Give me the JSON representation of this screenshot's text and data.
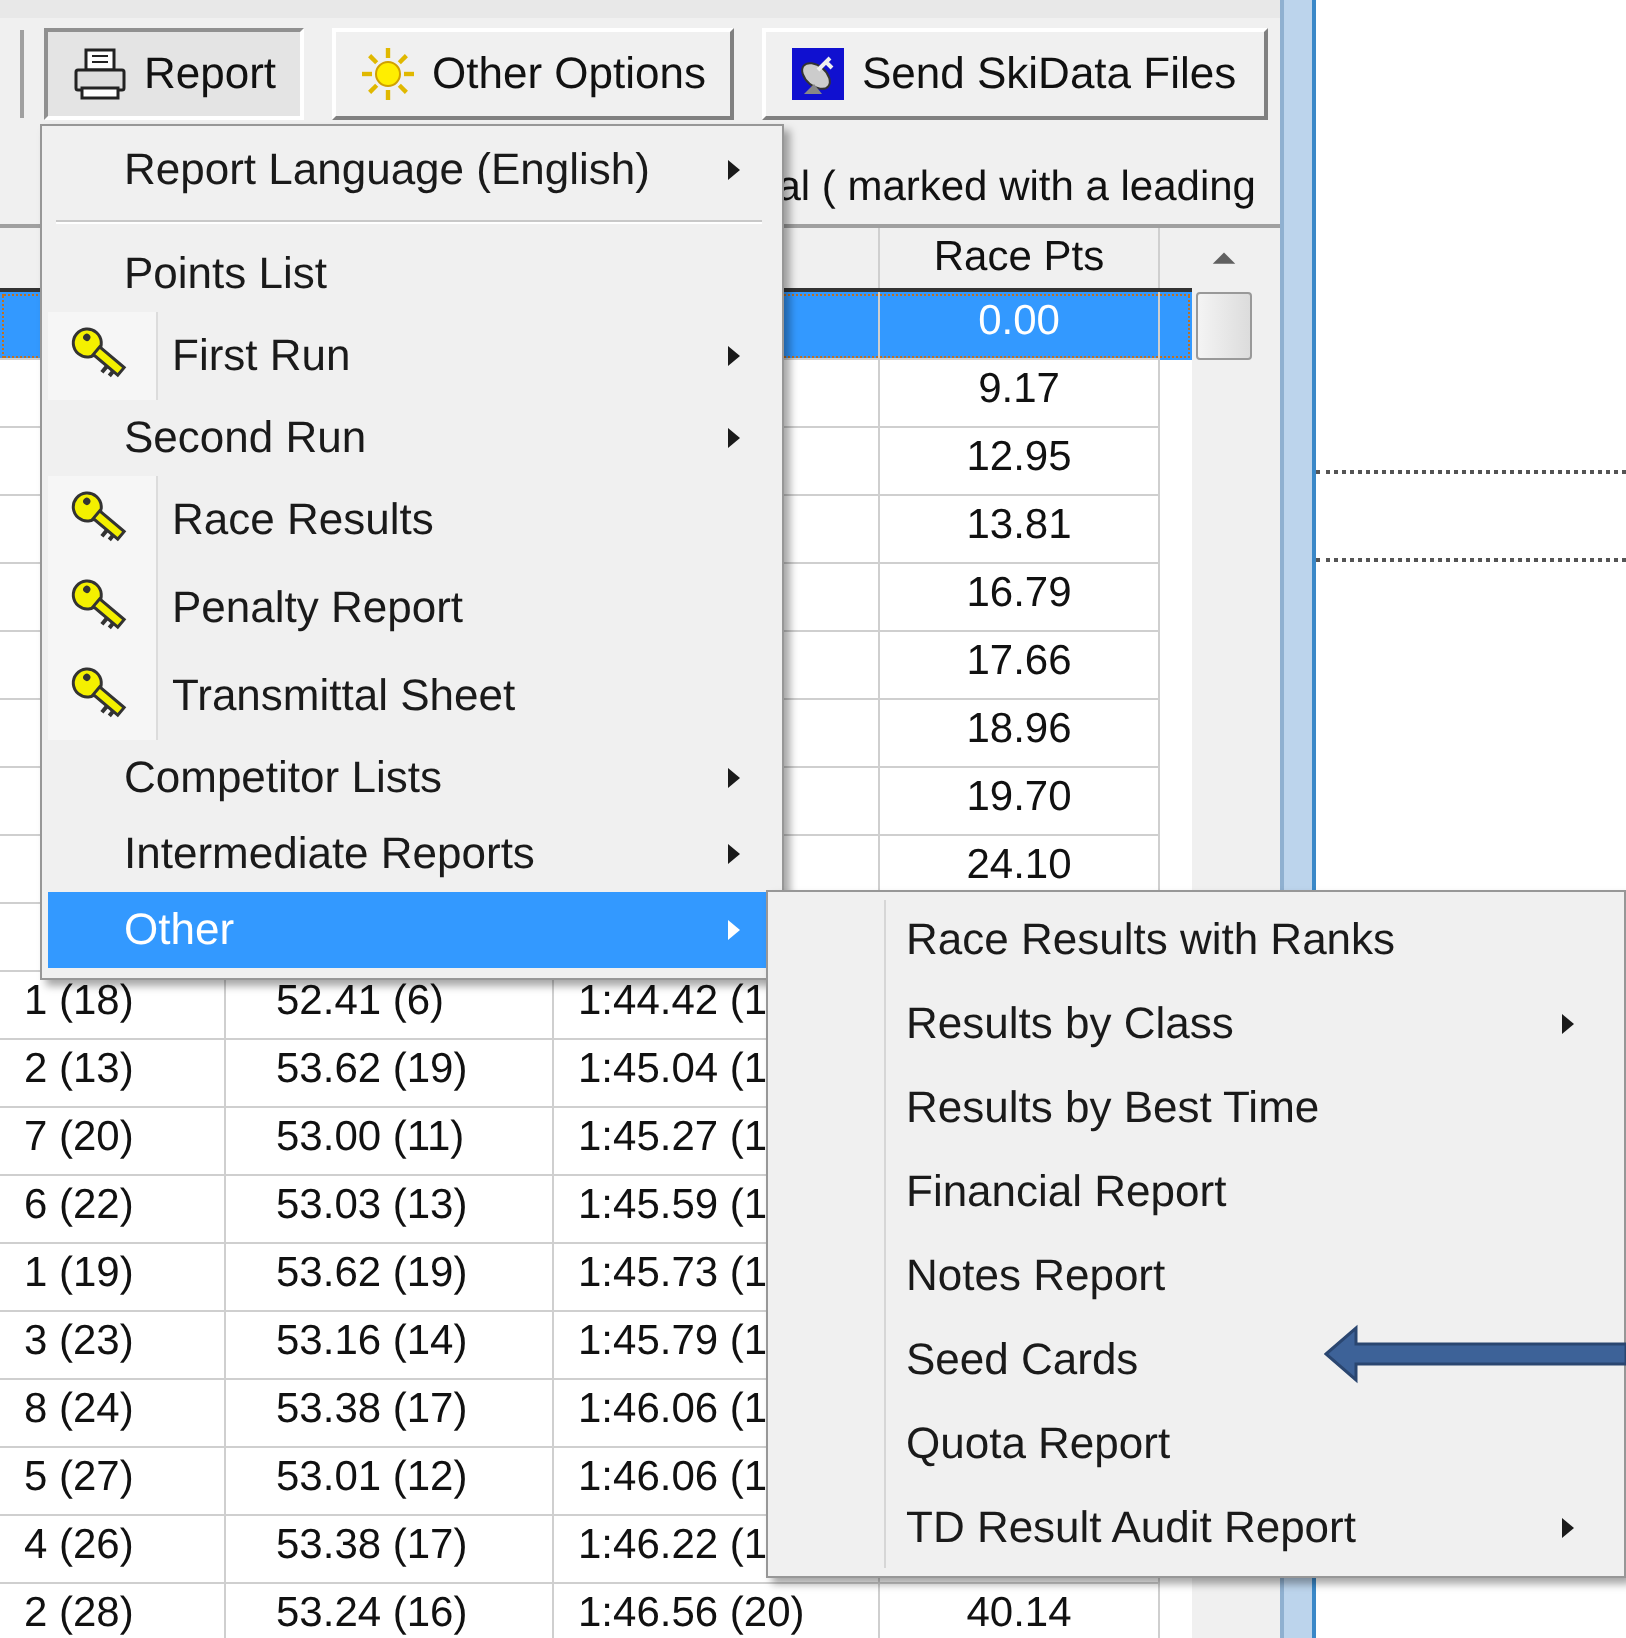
{
  "toolbar": [
    {
      "label": "Report",
      "pressed": true
    },
    {
      "label": "Other Options",
      "pressed": false
    },
    {
      "label": "Send SkiData Files",
      "pressed": false
    }
  ],
  "info_text": "al ( marked with a leading",
  "table": {
    "race_pts_header": "Race Pts",
    "rows": [
      {
        "selected": true,
        "race_pts": "0.00"
      },
      {
        "selected": false,
        "race_pts": "9.17"
      },
      {
        "selected": false,
        "race_pts": "12.95"
      },
      {
        "selected": false,
        "race_pts": "13.81"
      },
      {
        "selected": false,
        "race_pts": "16.79"
      },
      {
        "selected": false,
        "race_pts": "17.66"
      },
      {
        "selected": false,
        "race_pts": "18.96"
      },
      {
        "selected": false,
        "race_pts": "19.70"
      },
      {
        "selected": false,
        "race_pts": "24.10"
      },
      {
        "selected": false
      },
      {
        "selected": false,
        "column_1": "1 (18)",
        "column_2": "52.41 (6)",
        "column_3": "1:44.42 (1"
      },
      {
        "selected": false,
        "column_1": "2 (13)",
        "column_2": "53.62 (19)",
        "column_3": "1:45.04 (1"
      },
      {
        "selected": false,
        "column_1": "7 (20)",
        "column_2": "53.00 (11)",
        "column_3": "1:45.27 (1"
      },
      {
        "selected": false,
        "column_1": "6 (22)",
        "column_2": "53.03 (13)",
        "column_3": "1:45.59 (1"
      },
      {
        "selected": false,
        "column_1": "1 (19)",
        "column_2": "53.62 (19)",
        "column_3": "1:45.73 (1"
      },
      {
        "selected": false,
        "column_1": "3 (23)",
        "column_2": "53.16 (14)",
        "column_3": "1:45.79 (1"
      },
      {
        "selected": false,
        "column_1": "8 (24)",
        "column_2": "53.38 (17)",
        "column_3": "1:46.06 (1"
      },
      {
        "selected": false,
        "column_1": "5 (27)",
        "column_2": "53.01 (12)",
        "column_3": "1:46.06 (1"
      },
      {
        "selected": false,
        "column_1": "4 (26)",
        "column_2": "53.38 (17)",
        "column_3": "1:46.22 (1"
      },
      {
        "selected": false,
        "column_1": "2 (28)",
        "column_2": "53.24 (16)",
        "column_3": "1:46.56 (20)",
        "race_pts": "40.14"
      }
    ]
  },
  "menu": {
    "items": [
      {
        "kind": "plain",
        "label": "Report Language (English)",
        "submenu": true,
        "selected": false
      },
      {
        "kind": "separator"
      },
      {
        "kind": "plain",
        "label": "Points List",
        "submenu": false,
        "selected": false
      },
      {
        "kind": "key",
        "label": "First Run",
        "submenu": true,
        "selected": false
      },
      {
        "kind": "plain",
        "label": "Second Run",
        "submenu": true,
        "selected": false
      },
      {
        "kind": "key",
        "label": "Race Results",
        "submenu": false,
        "selected": false
      },
      {
        "kind": "key",
        "label": "Penalty Report",
        "submenu": false,
        "selected": false
      },
      {
        "kind": "key",
        "label": "Transmittal Sheet",
        "submenu": false,
        "selected": false
      },
      {
        "kind": "plain",
        "label": "Competitor Lists",
        "submenu": true,
        "selected": false
      },
      {
        "kind": "plain",
        "label": "Intermediate Reports",
        "submenu": true,
        "selected": false
      },
      {
        "kind": "plain",
        "label": "Other",
        "submenu": true,
        "selected": true
      }
    ]
  },
  "submenu": {
    "items": [
      {
        "label": "Race Results with Ranks",
        "submenu": false,
        "selected": false
      },
      {
        "label": "Results by Class",
        "submenu": true,
        "selected": false
      },
      {
        "label": "Results by Best Time",
        "submenu": false,
        "selected": false
      },
      {
        "label": "Financial Report",
        "submenu": false,
        "selected": false
      },
      {
        "label": "Notes Report",
        "submenu": false,
        "selected": false
      },
      {
        "label": "Seed Cards",
        "submenu": false,
        "selected": false
      },
      {
        "label": "Quota Report",
        "submenu": false,
        "selected": false
      },
      {
        "label": "TD Result Audit Report",
        "submenu": true,
        "selected": false
      }
    ]
  }
}
